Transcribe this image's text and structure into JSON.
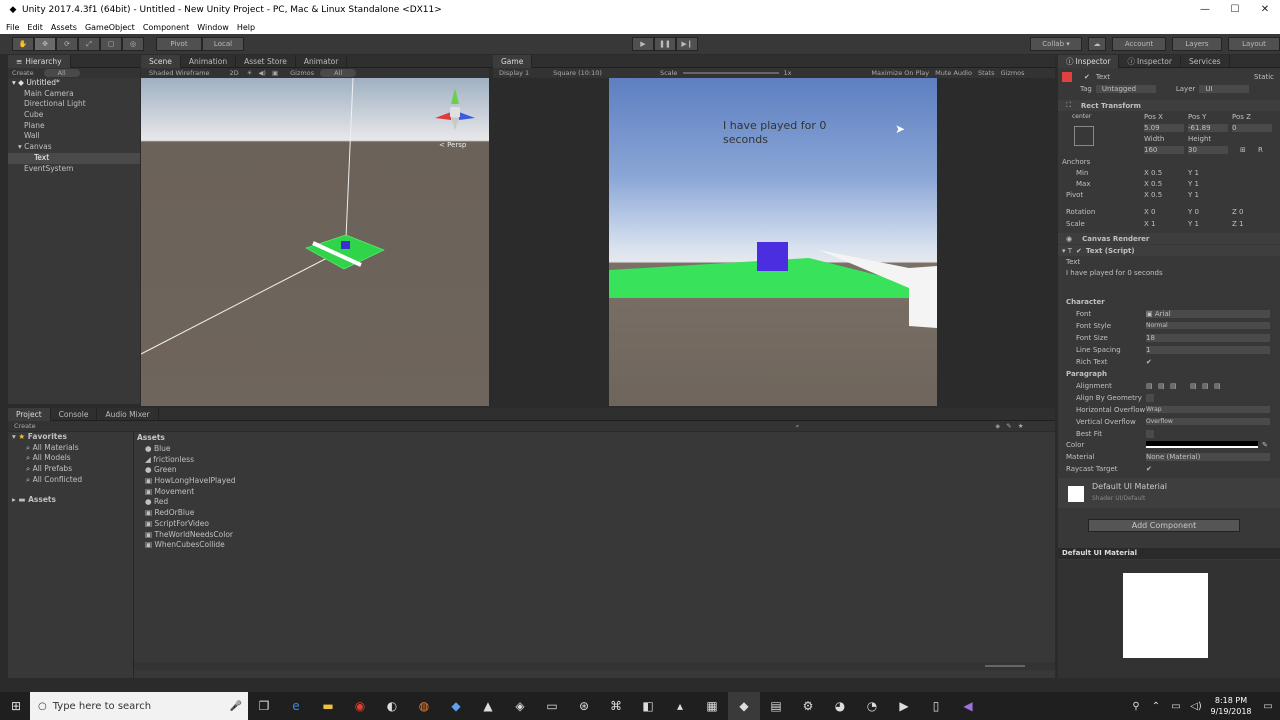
{
  "window": {
    "title": "Unity 2017.4.3f1 (64bit) - Untitled - New Unity Project - PC, Mac & Linux Standalone <DX11>",
    "min": "—",
    "max": "☐",
    "close": "✕"
  },
  "menu": [
    "File",
    "Edit",
    "Assets",
    "GameObject",
    "Component",
    "Window",
    "Help"
  ],
  "toolbar": {
    "pivot": "Pivot",
    "local": "Local",
    "collab": "Collab ▾",
    "account": "Account",
    "layers": "Layers",
    "layout": "Layout"
  },
  "hierarchy": {
    "tab": "Hierarchy",
    "create": "Create",
    "search": "All",
    "scene": "Untitled*",
    "items": [
      "Main Camera",
      "Directional Light",
      "Cube",
      "Plane",
      "Wall",
      "Canvas",
      "Text",
      "EventSystem"
    ]
  },
  "scene": {
    "tabs": [
      "Scene",
      "Animation",
      "Asset Store",
      "Animator"
    ],
    "shading": "Shaded Wireframe",
    "mode2d": "2D",
    "gizmos": "Gizmos",
    "search": "All",
    "persp": "< Persp"
  },
  "game": {
    "tab": "Game",
    "display": "Display 1",
    "aspect": "Square (10:10)",
    "scale_label": "Scale",
    "scale_value": "1x",
    "options": [
      "Maximize On Play",
      "Mute Audio",
      "Stats",
      "Gizmos"
    ],
    "ui_text": "I have played for 0 seconds"
  },
  "inspector": {
    "tabs": [
      "Inspector",
      "Inspector",
      "Services"
    ],
    "object_name": "Text",
    "static": "Static",
    "tag_label": "Tag",
    "tag": "Untagged",
    "layer_label": "Layer",
    "layer": "UI",
    "rect_transform": "Rect Transform",
    "anchor_preset": "center",
    "pos_x_label": "Pos X",
    "pos_y_label": "Pos Y",
    "pos_z_label": "Pos Z",
    "pos_x": "5.09",
    "pos_y": "-61.89",
    "pos_z": "0",
    "width_label": "Width",
    "height_label": "Height",
    "width": "160",
    "height": "30",
    "anchors": "Anchors",
    "min_label": "Min",
    "max_label": "Max",
    "pivot_label": "Pivot",
    "min_x": "0.5",
    "min_y": "1",
    "max_x": "0.5",
    "max_y": "1",
    "pivot_x": "0.5",
    "pivot_y": "1",
    "rotation_label": "Rotation",
    "scale_label": "Scale",
    "rot_x": "0",
    "rot_y": "0",
    "rot_z": "0",
    "scale_x": "1",
    "scale_y": "1",
    "scale_z": "1",
    "canvas_renderer": "Canvas Renderer",
    "text_script": "Text (Script)",
    "text_label": "Text",
    "text_value": "I have played for 0 seconds",
    "character": "Character",
    "font_label": "Font",
    "font": "Arial",
    "font_style_label": "Font Style",
    "font_style": "Normal",
    "font_size_label": "Font Size",
    "font_size": "18",
    "line_spacing_label": "Line Spacing",
    "line_spacing": "1",
    "rich_text_label": "Rich Text",
    "paragraph": "Paragraph",
    "alignment_label": "Alignment",
    "align_geometry_label": "Align By Geometry",
    "h_overflow_label": "Horizontal Overflow",
    "h_overflow": "Wrap",
    "v_overflow_label": "Vertical Overflow",
    "v_overflow": "Overflow",
    "best_fit_label": "Best Fit",
    "color_label": "Color",
    "material_label": "Material",
    "material": "None (Material)",
    "raycast_label": "Raycast Target",
    "default_material": "Default UI Material",
    "shader_label": "Shader",
    "shader": "UI/Default",
    "add_component": "Add Component",
    "preview_title": "Default UI Material"
  },
  "project": {
    "tabs": [
      "Project",
      "Console",
      "Audio Mixer"
    ],
    "create": "Create",
    "favorites": "Favorites",
    "fav_items": [
      "All Materials",
      "All Models",
      "All Prefabs",
      "All Conflicted"
    ],
    "assets_folder": "Assets",
    "breadcrumb": "Assets",
    "assets": [
      "Blue",
      "frictionless",
      "Green",
      "HowLongHaveIPlayed",
      "Movement",
      "Red",
      "RedOrBlue",
      "ScriptForVideo",
      "TheWorldNeedsColor",
      "WhenCubesCollide"
    ]
  },
  "taskbar": {
    "search_placeholder": "Type here to search",
    "time": "8:18 PM",
    "date": "9/19/2018"
  },
  "colors": {
    "selection": "#4a4a4a",
    "green_plane": "#38e25a",
    "cube_blue": "#4a2ee0"
  }
}
